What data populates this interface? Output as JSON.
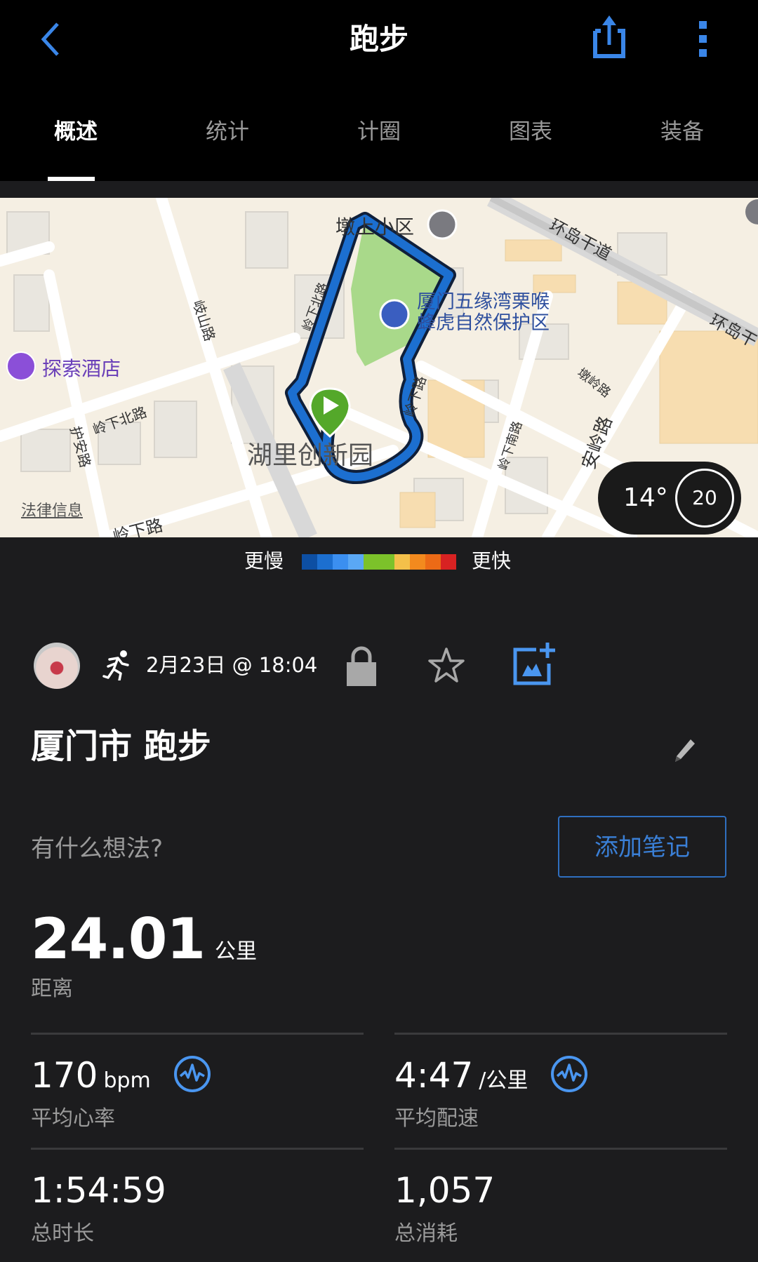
{
  "header": {
    "title": "跑步",
    "back_icon": "chevron-left-icon",
    "share_icon": "share-icon",
    "more_icon": "more-vertical-icon",
    "accent_color": "#3a86e8"
  },
  "tabs": [
    {
      "label": "概述",
      "active": true
    },
    {
      "label": "统计",
      "active": false
    },
    {
      "label": "计圈",
      "active": false
    },
    {
      "label": "图表",
      "active": false
    },
    {
      "label": "装备",
      "active": false
    }
  ],
  "map": {
    "labels": {
      "dunshang": "墩上小区",
      "reserve_line1": "厦门五缘湾栗喉",
      "reserve_line2": "蜂虎自然保护区",
      "hotel": "探索酒店",
      "park": "湖里创新园",
      "huandao1": "环岛干道",
      "huandao2": "环岛干",
      "qishan": "岐山路",
      "lingxiabei1": "岭下北路",
      "lingxiabei2": "岭下北路",
      "lingxia": "岭下路",
      "lingxia2": "岭下路",
      "lingxianan": "岭下南路",
      "dunling": "墩岭路",
      "anling": "安岭路",
      "huan": "护安路",
      "legal": "法律信息"
    },
    "weather": {
      "temperature": "14°",
      "wind": "20"
    }
  },
  "pace_legend": {
    "slower": "更慢",
    "faster": "更快",
    "colors": [
      "#0d4fa3",
      "#1c6fd0",
      "#3b8ff0",
      "#5aa8f5",
      "#7cc22a",
      "#7cc22a",
      "#f4c04a",
      "#f38a1e",
      "#ec6a16",
      "#d82222"
    ]
  },
  "activity": {
    "date": "2月23日 @ 18:04",
    "name": "厦门市 跑步",
    "prompt": "有什么想法?",
    "add_note_label": "添加笔记"
  },
  "distance": {
    "value": "24.01",
    "unit": "公里",
    "label": "距离"
  },
  "stats": [
    {
      "value": "170",
      "unit": "bpm",
      "label": "平均心率",
      "icon": "heart-rate-icon"
    },
    {
      "value": "4:47",
      "unit": "/公里",
      "label": "平均配速",
      "icon": "heart-rate-icon"
    },
    {
      "value": "1:54:59",
      "unit": "",
      "label": "总时长"
    },
    {
      "value": "1,057",
      "unit": "",
      "label": "总消耗"
    }
  ]
}
